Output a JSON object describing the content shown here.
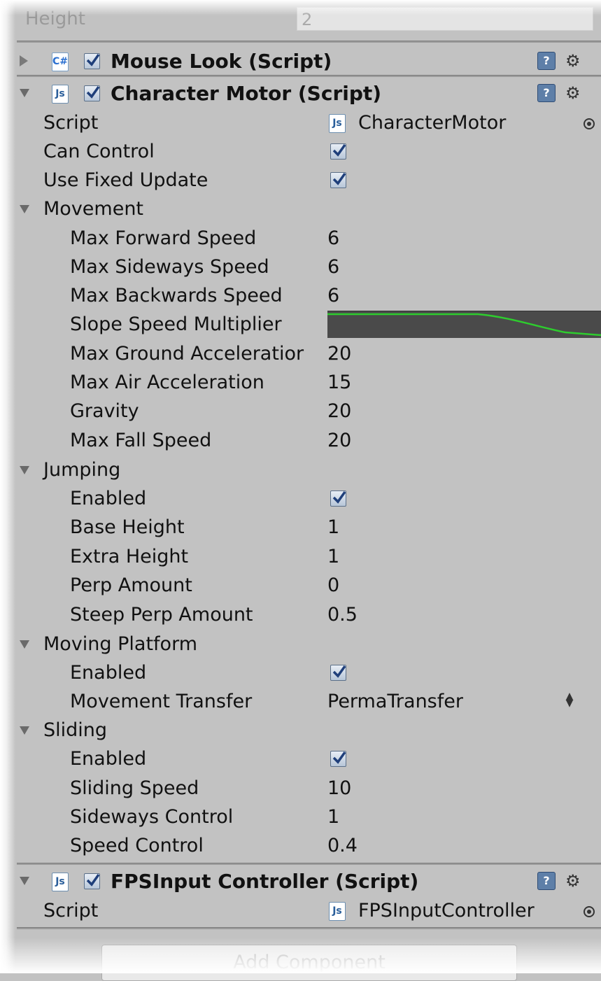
{
  "top_field": {
    "label": "Height",
    "value": "2"
  },
  "components": {
    "mouse_look": {
      "title": "Mouse Look (Script)",
      "icon": "cs-script-icon",
      "enabled": true,
      "expanded": false
    },
    "character_motor": {
      "title": "Character Motor (Script)",
      "icon": "js-script-icon",
      "enabled": true,
      "expanded": true,
      "script": {
        "label": "Script",
        "value": "CharacterMotor"
      },
      "can_control": {
        "label": "Can Control",
        "checked": true
      },
      "use_fixed_update": {
        "label": "Use Fixed Update",
        "checked": true
      },
      "movement": {
        "label": "Movement",
        "max_forward_speed": {
          "label": "Max Forward Speed",
          "value": "6"
        },
        "max_sideways_speed": {
          "label": "Max Sideways Speed",
          "value": "6"
        },
        "max_backwards_speed": {
          "label": "Max Backwards Speed",
          "value": "6"
        },
        "slope_speed_multiplier": {
          "label": "Slope Speed Multiplier",
          "curve_color": "#2ecc2e"
        },
        "max_ground_acceleration": {
          "label": "Max Ground Acceleratior",
          "value": "20"
        },
        "max_air_acceleration": {
          "label": "Max Air Acceleration",
          "value": "15"
        },
        "gravity": {
          "label": "Gravity",
          "value": "20"
        },
        "max_fall_speed": {
          "label": "Max Fall Speed",
          "value": "20"
        }
      },
      "jumping": {
        "label": "Jumping",
        "enabled": {
          "label": "Enabled",
          "checked": true
        },
        "base_height": {
          "label": "Base Height",
          "value": "1"
        },
        "extra_height": {
          "label": "Extra Height",
          "value": "1"
        },
        "perp_amount": {
          "label": "Perp Amount",
          "value": "0"
        },
        "steep_perp_amount": {
          "label": "Steep Perp Amount",
          "value": "0.5"
        }
      },
      "moving_platform": {
        "label": "Moving Platform",
        "enabled": {
          "label": "Enabled",
          "checked": true
        },
        "movement_transfer": {
          "label": "Movement Transfer",
          "value": "PermaTransfer"
        }
      },
      "sliding": {
        "label": "Sliding",
        "enabled": {
          "label": "Enabled",
          "checked": true
        },
        "sliding_speed": {
          "label": "Sliding Speed",
          "value": "10"
        },
        "sideways_control": {
          "label": "Sideways Control",
          "value": "1"
        },
        "speed_control": {
          "label": "Speed Control",
          "value": "0.4"
        }
      }
    },
    "fps_input_controller": {
      "title": "FPSInput Controller (Script)",
      "icon": "js-script-icon",
      "enabled": true,
      "expanded": true,
      "script": {
        "label": "Script",
        "value": "FPSInputController"
      }
    }
  },
  "add_component_label": "Add Component",
  "icons": {
    "cs": "C#",
    "js": "Js",
    "help": "?",
    "gear": "⚙"
  },
  "colors": {
    "panel_bg": "#c2c2c2",
    "curve_bg": "#4a4a4a",
    "curve_line": "#2ecc2e",
    "checkbox_check": "#1f3f7a"
  }
}
